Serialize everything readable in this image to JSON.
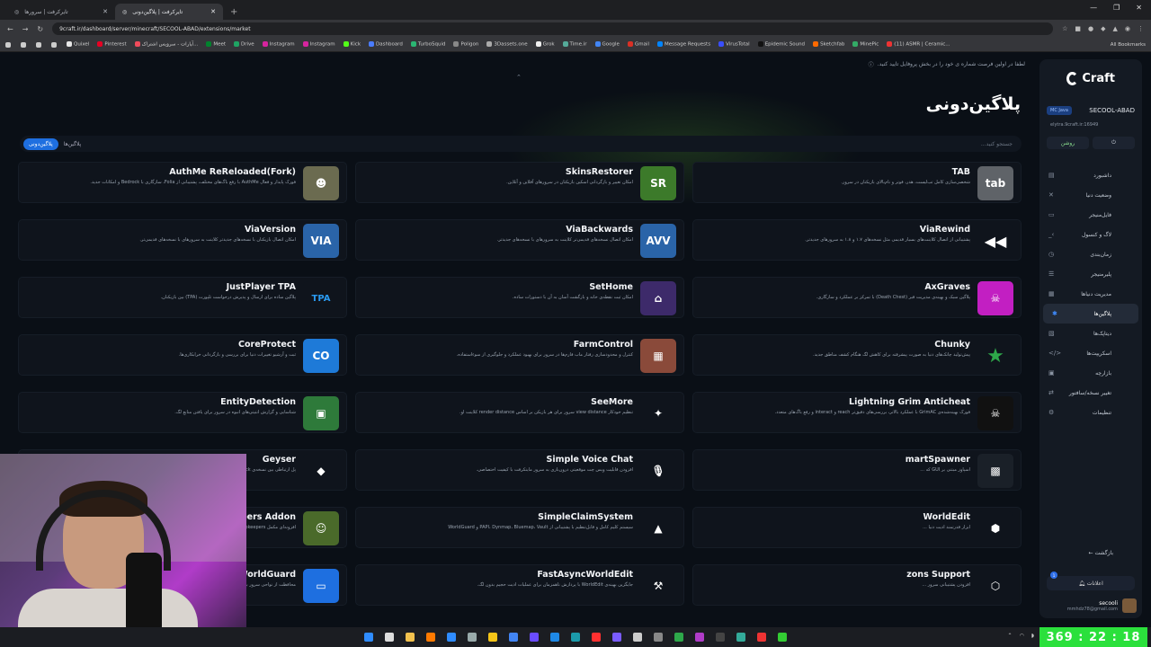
{
  "browser": {
    "tabs": [
      {
        "title": "تایرکرفت | سرورها"
      },
      {
        "title": "تایرکرفت | پلاگین‌دونی"
      }
    ],
    "url": "9craft.ir/dashboard/server/minecraft/SECOOL-ABAD/extensions/market",
    "bookmarks": [
      "Quixel",
      "Pinterest",
      "آپارات - سرویس اشتراک...",
      "Meet",
      "Drive",
      "Instagram",
      "Instagram",
      "Kick",
      "Dashboard",
      "TurboSquid",
      "Poligon",
      "3Dassets.one",
      "Grok",
      "Time.ir",
      "Google",
      "Gmail",
      "Message Requests",
      "VirusTotal",
      "Epidemic Sound",
      "Sketchfab",
      "MinePic",
      "(11) ASMR | Ceramic..."
    ],
    "all_bookmarks": "All Bookmarks"
  },
  "page": {
    "notice": "لطفا در اولین فرصت شماره ی خود را در بخش پروفایل تایید کنید.",
    "title": "پلاگین‌دونی",
    "tab_plugins": "پلاگین‌ها",
    "tab_pluginduni": "پلاگین‌دونی",
    "search_placeholder": "جستجو کنید..."
  },
  "plugins": [
    {
      "name": "TAB",
      "desc": "شخصی‌سازی کامل تب‌لیست، هدر، فوتر و نام‌بالای بازیکنان در سرور.",
      "icon": "tab",
      "color": "#5f6368"
    },
    {
      "name": "SkinsRestorer",
      "desc": "امکان تغییر و بازگردانی اسکین بازیکنان در سرورهای آفلاین و آنلاین.",
      "icon": "sr",
      "color": "#3c7a2a"
    },
    {
      "name": "AuthMe ReReloaded(Fork)",
      "desc": "فورک پایدار و فعال AuthMe با رفع باگ‌های مختلف، پشتیبانی از Folia، سازگاری با Bedrock و امکانات جدید.",
      "icon": "authme",
      "color": "#6b6b50"
    },
    {
      "name": "ViaRewind",
      "desc": "پشتیبانی از اتصال کلاینت‌های بسیار قدیمی مثل نسخه‌های ۱.۷ و ۱.۸ به سرورهای جدیدتر.",
      "icon": "rewind",
      "color": "#0f141c"
    },
    {
      "name": "ViaBackwards",
      "desc": "امکان اتصال نسخه‌های قدیمی‌تر کلاینت به سرورهای با نسخه‌های جدیدتر.",
      "icon": "avv",
      "color": "#2a64a8"
    },
    {
      "name": "ViaVersion",
      "desc": "امکان اتصال بازیکنان با نسخه‌های جدیدتر کلاینت به سرورهای با نسخه‌های قدیمی‌تر.",
      "icon": "via",
      "color": "#2a64a8"
    },
    {
      "name": "AxGraves",
      "desc": "پلاگین سبک و بهینه‌ی مدیریت قبر (Death Chest) با تمرکز بر عملکرد و سازگاری.",
      "icon": "grave",
      "color": "#c21fc2"
    },
    {
      "name": "SetHome",
      "desc": "امکان ثبت نقطه‌ی خانه و بازگشت آسان به آن با دستورات ساده.",
      "icon": "sethome",
      "color": "#3d2a6a"
    },
    {
      "name": "JustPlayer TPA",
      "desc": "پلاگین ساده برای ارسال و پذیرش درخواست تلپورت (TPA) بین بازیکنان.",
      "icon": "tpa",
      "color": "#0f141c"
    },
    {
      "name": "Chunky",
      "desc": "پیش‌تولید چانک‌های دنیا به صورت پیشرفته برای کاهش لگ هنگام کشف مناطق جدید.",
      "icon": "star",
      "color": "#0f141c"
    },
    {
      "name": "FarmControl",
      "desc": "کنترل و محدودسازی رفتار ماب فارم‌ها در سرور برای بهبود عملکرد و جلوگیری از سوءاستفاده.",
      "icon": "farm",
      "color": "#8a4a3a"
    },
    {
      "name": "CoreProtect",
      "desc": "ثبت و آرشیو تغییرات دنیا برای بررسی و بازگردانی خرابکاری‌ها.",
      "icon": "co",
      "color": "#1e7ad8"
    },
    {
      "name": "Lightning Grim Anticheat",
      "desc": "فورک بهینه‌شده‌ی GrimAC با عملکرد بالاتر، بررسی‌های دقیق‌تر reach و interact و رفع باگ‌های متعدد.",
      "icon": "skull",
      "color": "#111"
    },
    {
      "name": "SeeMore",
      "desc": "تنظیم خودکار view distance سرور برای هر بازیکن بر اساس render distance کلاینت او.",
      "icon": "torch",
      "color": "#0f141c"
    },
    {
      "name": "EntityDetection",
      "desc": "شناسایی و گزارش انتیتی‌های انبوه در سرور برای یافتن منابع لگ.",
      "icon": "sheep",
      "color": "#2e7a3a"
    },
    {
      "name": "martSpawner",
      "desc": "اسپاوز مبتنی بر GUI که ...",
      "icon": "spawner",
      "color": "#1a2028"
    },
    {
      "name": "Simple Voice Chat",
      "desc": "افزودن قابلیت ویس چت موقعیتی درون‌بازی به سرور ماینکرفت با کیفیت اختصاصی.",
      "icon": "mic",
      "color": "#0f141c"
    },
    {
      "name": "Geyser",
      "desc": "پل ارتباطی بین نسخه‌ی Bedrock و سرورهای Java برای اتصال همزمان هر دو پلتفرم.",
      "icon": "geyser",
      "color": "#0f141c"
    },
    {
      "name": "WorldEdit",
      "desc": "ابزار قدرتمند ادیت دنیا ...",
      "icon": "we",
      "color": "#0f141c"
    },
    {
      "name": "SimpleClaimSystem",
      "desc": "سیستم کلیم کامل و قابل‌تنظیم با پشتیبانی از PAPI، Dynmap، Bluemap، Vault و WorldGuard",
      "icon": "claim",
      "color": "#0f141c"
    },
    {
      "name": "Shopkeepers Addon",
      "desc": "افزونه‌ای مکمل Shopkeepers برای بهبود رابط کاربری و مدیریت راحت‌تر فروشنده‌ها.",
      "icon": "villager",
      "color": "#4a6a2a"
    },
    {
      "name": "zons Support",
      "desc": "افزودن پشتیبانی سرور ...",
      "icon": "hex",
      "color": "#0f141c"
    },
    {
      "name": "FastAsyncWorldEdit",
      "desc": "جایگزین بهینه‌ی WorldEdit با پردازش ناهمزمان برای عملیات ادیت حجیم بدون لگ.",
      "icon": "axe",
      "color": "#0f141c"
    },
    {
      "name": "WorldGuard",
      "desc": "محافظت از نواحی سرور با قوانین قابل‌تنظیم برای جلوگیری از خرابکاری و کنترل دسترسی.",
      "icon": "wg",
      "color": "#1e6fe0"
    }
  ],
  "sidebar": {
    "brand": "Craft",
    "server_name": "SECOOL-ABAD",
    "edition_badge": "MC Java",
    "address": "elytra.9craft.ir:16949",
    "status": "روشن",
    "items": [
      {
        "label": "داشبورد",
        "icon": "dashboard-icon"
      },
      {
        "label": "وضعیت دنیا",
        "icon": "world-icon"
      },
      {
        "label": "فایل‌منیجر",
        "icon": "folder-icon"
      },
      {
        "label": "لاگ و کنسول",
        "icon": "console-icon"
      },
      {
        "label": "زمان‌بندی",
        "icon": "clock-icon"
      },
      {
        "label": "پلیرمنیجر",
        "icon": "players-icon"
      },
      {
        "label": "مدیریت دنیاها",
        "icon": "worlds-icon"
      },
      {
        "label": "پلاگین‌ها",
        "icon": "plugin-icon"
      },
      {
        "label": "دیتاپک‌ها",
        "icon": "datapack-icon"
      },
      {
        "label": "اسکریپت‌ها",
        "icon": "script-icon"
      },
      {
        "label": "بازارچه",
        "icon": "shop-icon"
      },
      {
        "label": "تغییر نسخه/سافتور",
        "icon": "version-icon"
      },
      {
        "label": "تنظیمات",
        "icon": "settings-icon"
      }
    ],
    "back": "بازگشت",
    "notifications": "اعلانات",
    "notif_count": "1",
    "username": "secooli",
    "email": "mmhdz78@gmail.com"
  },
  "clock": "369 : 22 : 18",
  "colors": {
    "accent": "#1e6fe0",
    "clock_bg": "#2be03c"
  }
}
